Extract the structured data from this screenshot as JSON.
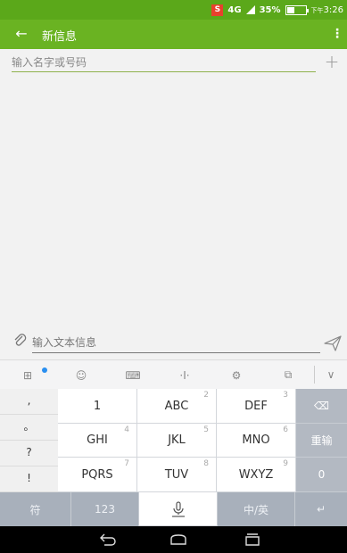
{
  "status_bar": {
    "carrier_badge": "S",
    "network": "4G",
    "battery_percent": "35%",
    "time_prefix": "下午",
    "time": "3:26"
  },
  "app_bar": {
    "title": "新信息",
    "back_icon": "arrow-left-icon",
    "menu_icon": "more-vert-icon",
    "menu_glyph": "⋮",
    "back_glyph": "←"
  },
  "recipient": {
    "placeholder": "输入名字或号码",
    "add_glyph": "+"
  },
  "composer": {
    "placeholder": "输入文本信息",
    "attach_glyph": "🖇"
  },
  "keyboard_toolbar": {
    "items": [
      {
        "name": "grid-icon",
        "glyph": "⊞"
      },
      {
        "name": "emoji-icon",
        "glyph": "☺"
      },
      {
        "name": "keyboard-icon",
        "glyph": "⌨"
      },
      {
        "name": "cursor-icon",
        "glyph": "·I·"
      },
      {
        "name": "settings-icon",
        "glyph": "⚙"
      },
      {
        "name": "clipboard-icon",
        "glyph": "⧉"
      },
      {
        "name": "collapse-icon",
        "glyph": "∨"
      }
    ]
  },
  "keyboard": {
    "symbols": [
      ",",
      "。",
      "?",
      "!"
    ],
    "rows": [
      [
        {
          "label": "1",
          "num": ""
        },
        {
          "label": "ABC",
          "num": "2"
        },
        {
          "label": "DEF",
          "num": "3"
        }
      ],
      [
        {
          "label": "GHI",
          "num": "4"
        },
        {
          "label": "JKL",
          "num": "5"
        },
        {
          "label": "MNO",
          "num": "6"
        }
      ],
      [
        {
          "label": "PQRS",
          "num": "7"
        },
        {
          "label": "TUV",
          "num": "8"
        },
        {
          "label": "WXYZ",
          "num": "9"
        }
      ]
    ],
    "right_keys": [
      "⌫",
      "重输",
      "0"
    ],
    "bottom_keys": {
      "symbol": "符",
      "num": "123",
      "space": "🎙",
      "lang": "中/英",
      "enter": "↵"
    }
  },
  "navbar": {
    "back": "⮌",
    "home": "home-icon",
    "recents": "recents-icon"
  },
  "colors": {
    "status_bar": "#5ba81a",
    "app_bar": "#6ab322",
    "function_key": "#b3b9c2"
  }
}
